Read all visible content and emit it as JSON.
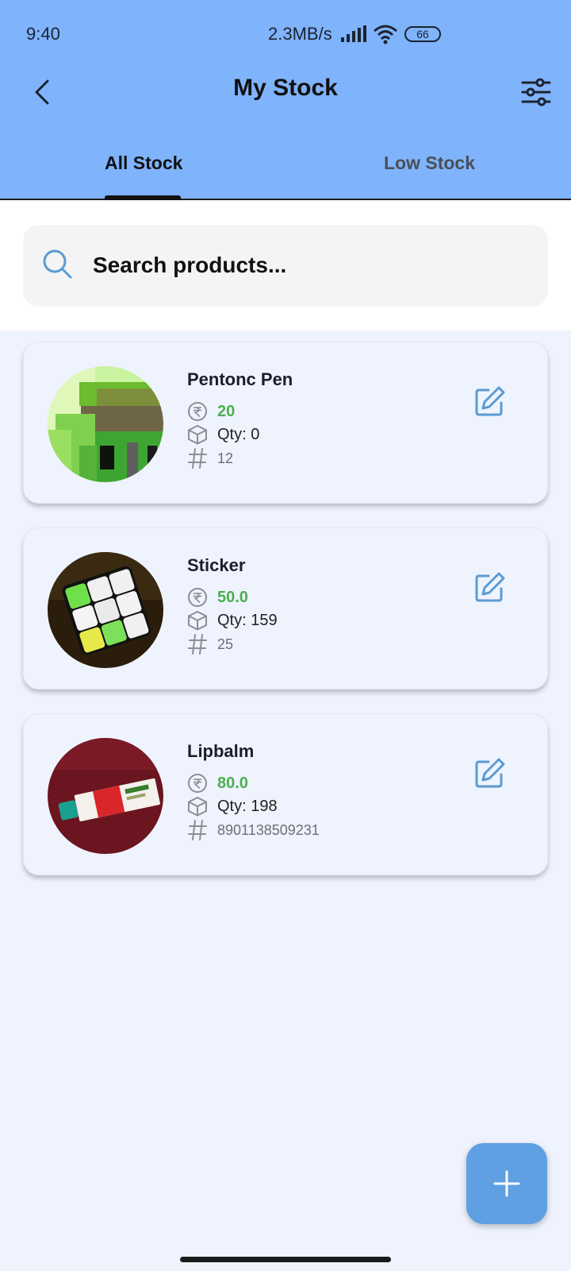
{
  "status_bar": {
    "time": "9:40",
    "network_speed": "2.3MB/s",
    "battery": "66",
    "icons": [
      "signal-icon",
      "wifi-icon",
      "battery-icon"
    ]
  },
  "header": {
    "title": "My Stock",
    "back_icon": "chevron-left-icon",
    "filter_icon": "sliders-icon",
    "background_color": "#7fb3fc"
  },
  "tabs": [
    {
      "label": "All Stock",
      "active": true
    },
    {
      "label": "Low Stock",
      "active": false
    }
  ],
  "search": {
    "placeholder": "Search products...",
    "value": ""
  },
  "products": [
    {
      "name": "Pentonc Pen",
      "price": "20",
      "qty": "Qty: 0",
      "code": "12",
      "image": "pixel-art-building-thumbnail"
    },
    {
      "name": "Sticker",
      "price": "50.0",
      "qty": "Qty: 159",
      "code": "25",
      "image": "rubiks-cube-photo-thumbnail"
    },
    {
      "name": "Lipbalm",
      "price": "80.0",
      "qty": "Qty: 198",
      "code": "8901138509231",
      "image": "lip-balm-tube-photo-thumbnail"
    }
  ],
  "colors": {
    "price_green": "#4caf50",
    "accent_blue": "#5fa0e3",
    "list_background": "#eef3fd"
  },
  "fab_icon": "plus-icon"
}
